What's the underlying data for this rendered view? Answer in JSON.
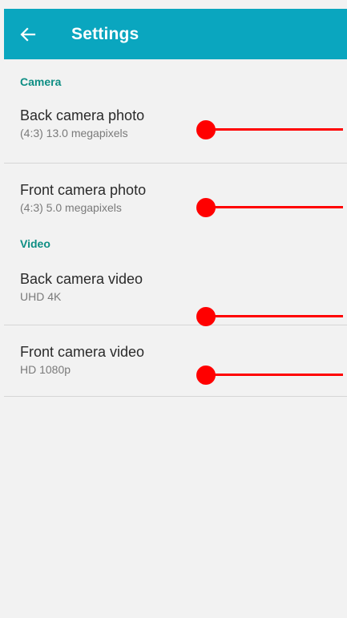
{
  "app_bar": {
    "title": "Settings",
    "back_icon": "arrow-left-icon",
    "background": "#0aa6bf"
  },
  "sections": [
    {
      "header": "Camera",
      "items": [
        {
          "title": "Back camera photo",
          "subtitle": "(4:3) 13.0 megapixels"
        },
        {
          "title": "Front camera photo",
          "subtitle": "(4:3) 5.0 megapixels"
        }
      ]
    },
    {
      "header": "Video",
      "items": [
        {
          "title": "Back camera video",
          "subtitle": "UHD 4K"
        },
        {
          "title": "Front camera video",
          "subtitle": "HD 1080p"
        }
      ]
    }
  ],
  "accent_color": "#0e8e84",
  "marker_color": "#ff0000"
}
